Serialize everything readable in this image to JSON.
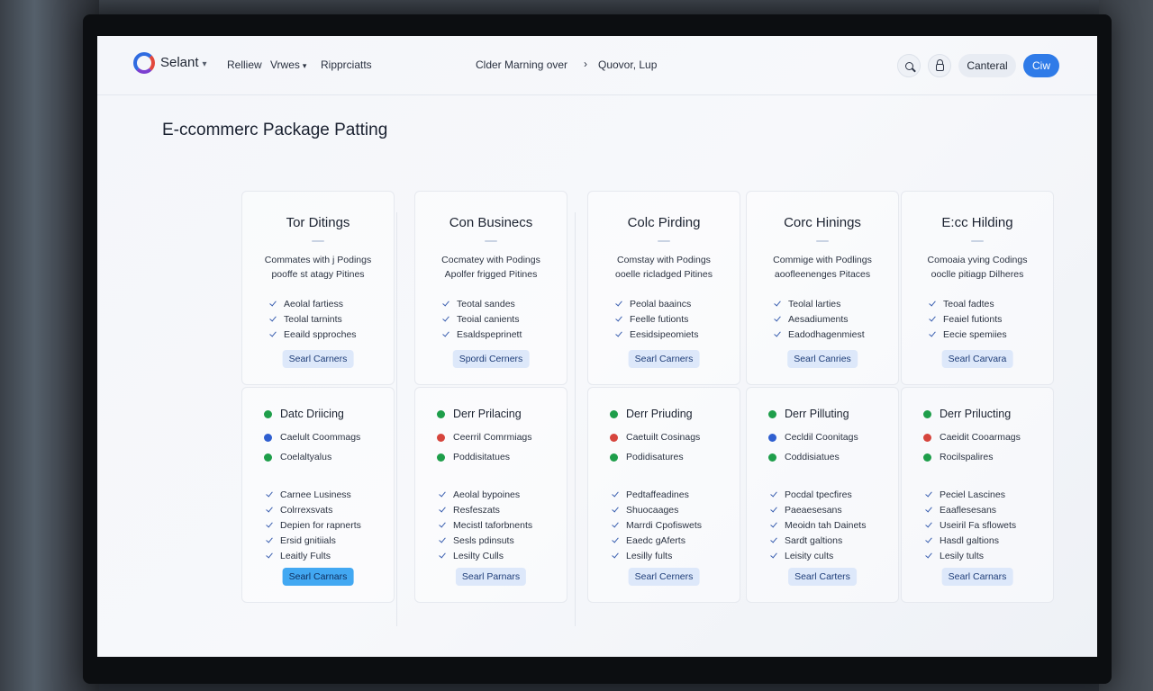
{
  "header": {
    "brand": "Selant",
    "nav": [
      {
        "label": "Relliew",
        "caret": ""
      },
      {
        "label": "Vrwes",
        "caret": "▾"
      },
      {
        "label": "Ripprciatts",
        "caret": ""
      }
    ],
    "breadcrumb": [
      "Clder Marning over",
      "Quovor, Lup"
    ],
    "breadcrumb_separator": "›",
    "cancel_label": "Canteral",
    "primary_label": "Ciw"
  },
  "page_title": "E-ccommerc Package Patting",
  "colors": {
    "accent": "#2f7be8",
    "status_green": "#1e9e4a",
    "status_blue": "#2f5fd0",
    "status_red": "#d6453d"
  },
  "plans": [
    {
      "title": "Tor Ditings",
      "desc": [
        "Commates with j Podings",
        "pooffe st atagy Pitines"
      ],
      "checks": [
        "Aeolal fartiess",
        "Teolal tarnints",
        "Eeaild spproches"
      ],
      "select_label": "Searl Carners",
      "section_title": "Datc Driicing",
      "statuses": [
        {
          "label": "Caelult Coommags",
          "color": "blue"
        },
        {
          "label": "Coelaltyalus",
          "color": "green"
        }
      ],
      "features": [
        "Carnee Lusiness",
        "Colrrexsvats",
        "Depien for rapnerts",
        "Ersid gnitiials",
        "Leaitly Fults"
      ],
      "bottom_label": "Searl Carnars",
      "bottom_active": true
    },
    {
      "title": "Con Businecs",
      "desc": [
        "Cocmatey with Podings",
        "Apolfer frigged Pitines"
      ],
      "checks": [
        "Teotal sandes",
        "Teoial canients",
        "Esaldspeprinett"
      ],
      "select_label": "Spordi Cerners",
      "section_title": "Derr Prilacing",
      "statuses": [
        {
          "label": "Ceerril Comrmiags",
          "color": "red"
        },
        {
          "label": "Poddisitatues",
          "color": "green"
        }
      ],
      "features": [
        "Aeolal bypoines",
        "Resfeszats",
        "Mecistl taforbnents",
        "Sesls pdinsuts",
        "Lesilty Culls"
      ],
      "bottom_label": "Searl Parnars",
      "bottom_active": false
    },
    {
      "title": "Colc Pirding",
      "desc": [
        "Comstay with Podings",
        "ooelle ricladged Pitines"
      ],
      "checks": [
        "Peolal baaincs",
        "Feelle futionts",
        "Eesidsipeomiets"
      ],
      "select_label": "Searl Carners",
      "section_title": "Derr Priuding",
      "statuses": [
        {
          "label": "Caetuilt Cosinags",
          "color": "red"
        },
        {
          "label": "Podidisatures",
          "color": "green"
        }
      ],
      "features": [
        "Pedtaffeadines",
        "Shuocaages",
        "Marrdi Cpofiswets",
        "Eaedc gAferts",
        "Lesilly fults"
      ],
      "bottom_label": "Searl Cerners",
      "bottom_active": false
    },
    {
      "title": "Corc Hinings",
      "desc": [
        "Commige with Podlings",
        "aoofleenenges Pitaces"
      ],
      "checks": [
        "Teolal larties",
        "Aesadiuments",
        "Eadodhagenmiest"
      ],
      "select_label": "Searl Canries",
      "section_title": "Derr Pilluting",
      "statuses": [
        {
          "label": "Cecldil Coonitags",
          "color": "blue"
        },
        {
          "label": "Coddisiatues",
          "color": "green"
        }
      ],
      "features": [
        "Pocdal tpecfires",
        "Paeaesesans",
        "Meoidn tah Dainets",
        "Sardt galtions",
        "Leisity cults"
      ],
      "bottom_label": "Searl Carters",
      "bottom_active": false
    },
    {
      "title": "E:cc Hilding",
      "desc": [
        "Comoaia yving Codings",
        "ooclle pitiagp Dilheres"
      ],
      "checks": [
        "Teoal fadtes",
        "Feaiel futionts",
        "Eecie spemiies"
      ],
      "select_label": "Searl Carvara",
      "section_title": "Derr Prilucting",
      "statuses": [
        {
          "label": "Caeidit Cooarmags",
          "color": "red"
        },
        {
          "label": "Rocilspalires",
          "color": "green"
        }
      ],
      "features": [
        "Peciel Lascines",
        "Eaaflesesans",
        "Useiril Fa sflowets",
        "Hasdl galtions",
        "Lesily tults"
      ],
      "bottom_label": "Searl Carnars",
      "bottom_active": false
    }
  ]
}
